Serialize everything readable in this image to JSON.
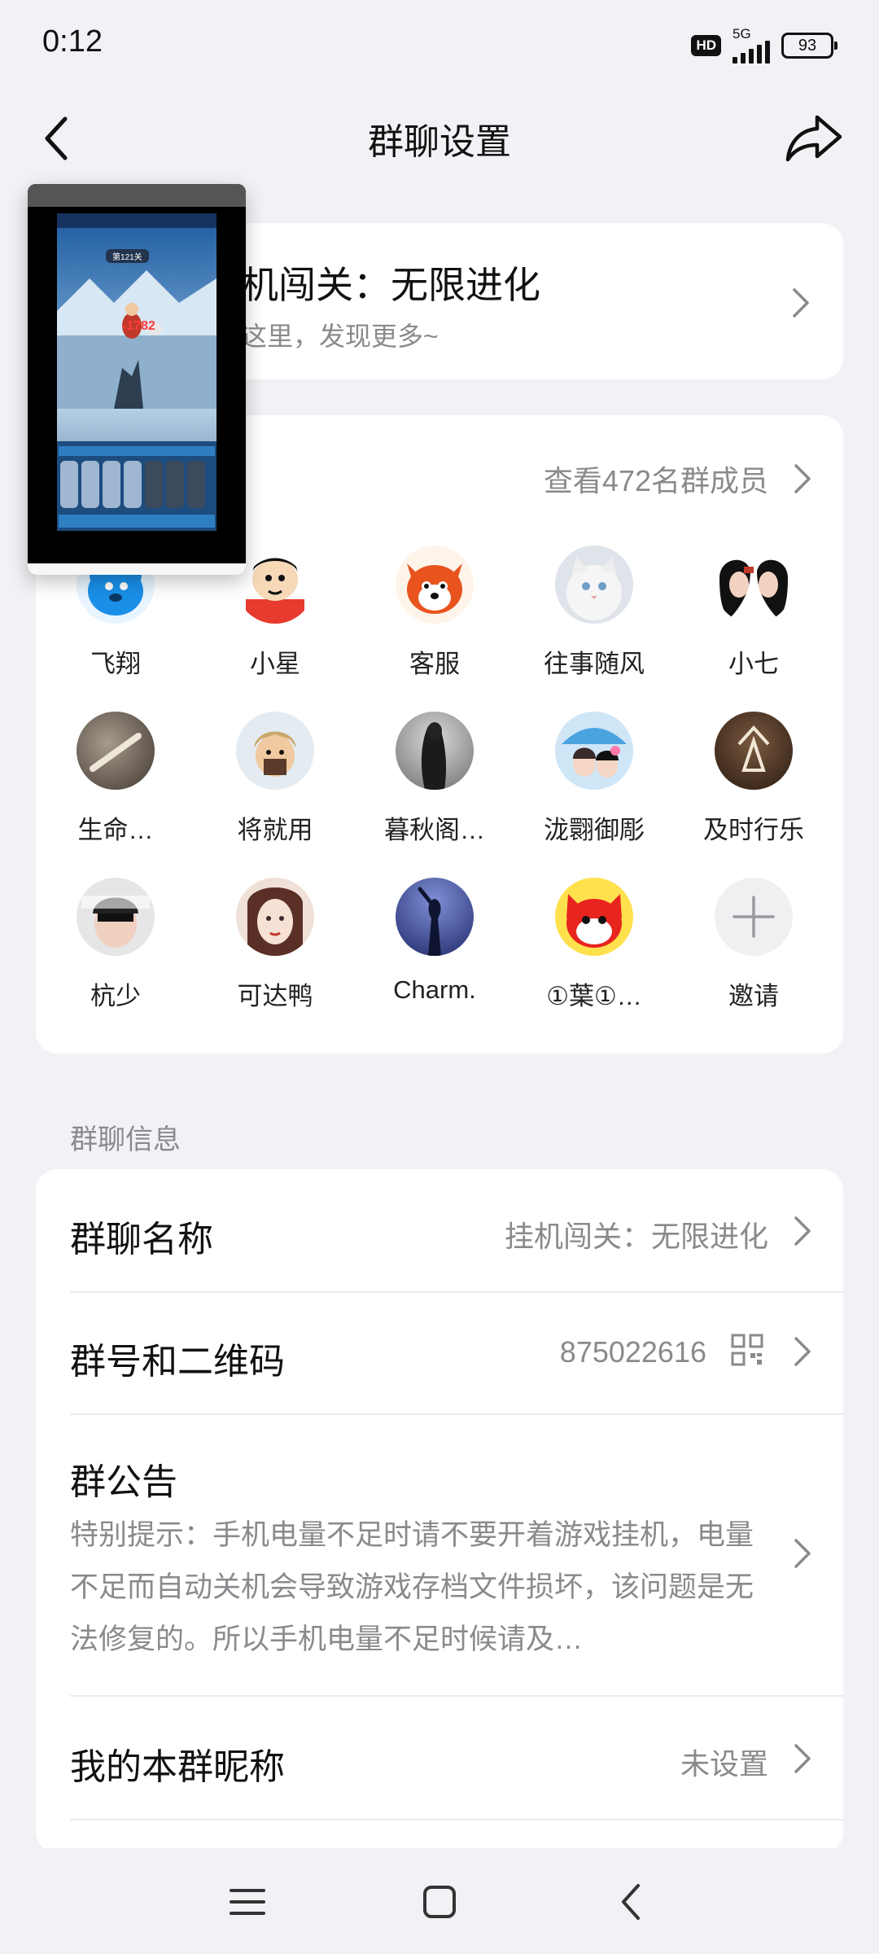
{
  "status_bar": {
    "time": "0:12",
    "hd": "HD",
    "network": "5G",
    "battery": "93"
  },
  "header": {
    "title": "群聊设置"
  },
  "group_card": {
    "name": "机闯关：无限进化",
    "hint": "这里，发现更多~"
  },
  "members": {
    "view_all": "查看472名群成员",
    "list": [
      {
        "name": "飞翔"
      },
      {
        "name": "小星"
      },
      {
        "name": "客服"
      },
      {
        "name": "往事随风"
      },
      {
        "name": "小七"
      },
      {
        "name": "生命…"
      },
      {
        "name": "将就用"
      },
      {
        "name": "暮秋阁…"
      },
      {
        "name": "泷翾御彫"
      },
      {
        "name": "及时行乐"
      },
      {
        "name": "杭少"
      },
      {
        "name": "可达鸭"
      },
      {
        "name": "Charm."
      },
      {
        "name": "①葉①…"
      }
    ],
    "invite_label": "邀请"
  },
  "info_section": {
    "label": "群聊信息",
    "group_name_label": "群聊名称",
    "group_name_value": "挂机闯关：无限进化",
    "group_id_label": "群号和二维码",
    "group_id_value": "875022616",
    "announcement_label": "群公告",
    "announcement_text": "特别提示：手机电量不足时请不要开着游戏挂机，电量不足而自动关机会导致游戏存档文件损坏，该问题是无法修复的。所以手机电量不足时候请及…",
    "nickname_label": "我的本群昵称",
    "nickname_value": "未设置"
  },
  "floating_window": {
    "stage_label": "第121关",
    "damage_text": "-1782"
  },
  "colors": {
    "background": "#f2f2f6",
    "card": "#ffffff",
    "secondary_text": "#8a8a8e"
  }
}
